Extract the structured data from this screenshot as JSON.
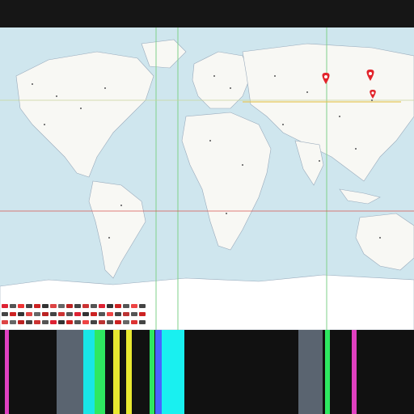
{
  "map": {
    "ocean_color": "#cfe6ee",
    "land_color": "#f8f8f4",
    "border_color": "#9ab",
    "grid_color": "#7fd18a",
    "tropic_color": "#d9534f",
    "highlight_line_color": "#e6c85c",
    "marker_color": "#e2242b",
    "badge_text": "",
    "markers": [
      {
        "name": "marker-1"
      },
      {
        "name": "marker-2"
      },
      {
        "name": "marker-3"
      }
    ]
  },
  "legend": {
    "chip_colors": [
      "#d23",
      "#555",
      "#e33",
      "#444",
      "#c22",
      "#333",
      "#d44",
      "#666",
      "#b22",
      "#444",
      "#c33",
      "#555",
      "#d23",
      "#333",
      "#c22",
      "#555",
      "#e44",
      "#444",
      "#b33",
      "#555",
      "#c22",
      "#666",
      "#d33",
      "#444"
    ]
  },
  "bottom_band": {
    "stripes": [
      {
        "color": "#e040c0"
      },
      {
        "color": "#5a6470"
      },
      {
        "color": "#19e6e6"
      },
      {
        "color": "#2ee860"
      },
      {
        "color": "#e8e830"
      },
      {
        "color": "#4a62ff"
      },
      {
        "color": "#19f0f0"
      },
      {
        "color": "#5a6470"
      },
      {
        "color": "#2ee860"
      },
      {
        "color": "#e040c0"
      }
    ]
  }
}
